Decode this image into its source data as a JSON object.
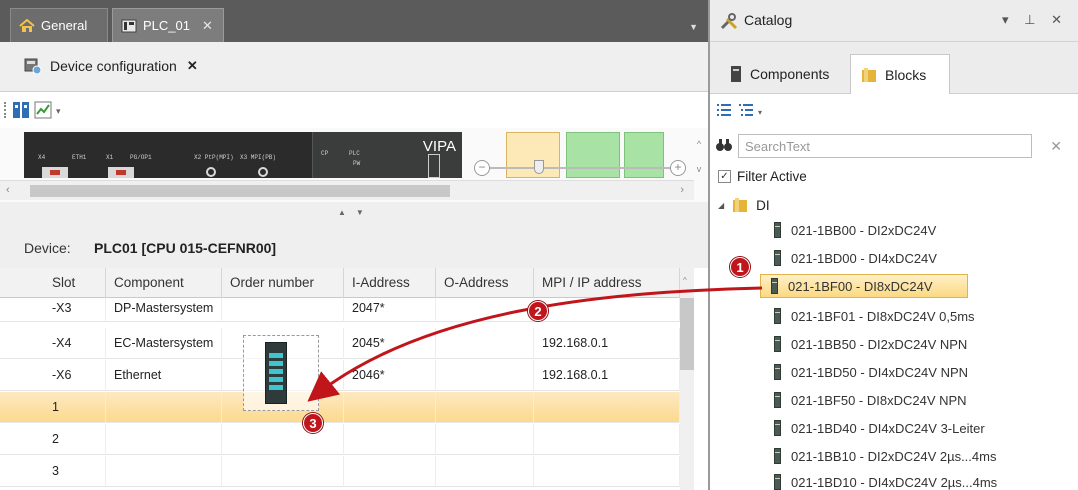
{
  "doc_tabs": [
    {
      "label": "General"
    },
    {
      "label": "PLC_01"
    }
  ],
  "sub_tab": {
    "label": "Device configuration"
  },
  "rack": {
    "labels": [
      "X4",
      "ETH1",
      "X1",
      "PG/OP1",
      "X2 PtP(MPI)",
      "X3 MPI(PB)",
      "CP",
      "PLC",
      "PW"
    ],
    "brand": "VIPA"
  },
  "device": {
    "label": "Device:",
    "name": "PLC01 [CPU 015-CEFNR00]"
  },
  "grid": {
    "columns": [
      "Slot",
      "Component",
      "Order number",
      "I-Address",
      "O-Address",
      "MPI / IP address"
    ],
    "rows": [
      {
        "slot": "-X3",
        "component": "DP-Mastersystem",
        "order": "",
        "iaddr": "2047*",
        "oaddr": "",
        "ip": ""
      },
      {
        "slot": "-X4",
        "component": "EC-Mastersystem",
        "order": "",
        "iaddr": "2045*",
        "oaddr": "",
        "ip": "192.168.0.1"
      },
      {
        "slot": "-X6",
        "component": "Ethernet",
        "order": "",
        "iaddr": "2046*",
        "oaddr": "",
        "ip": "192.168.0.1"
      },
      {
        "slot": "1",
        "component": "",
        "order": "",
        "iaddr": "",
        "oaddr": "",
        "ip": ""
      },
      {
        "slot": "2",
        "component": "",
        "order": "",
        "iaddr": "",
        "oaddr": "",
        "ip": ""
      },
      {
        "slot": "3",
        "component": "",
        "order": "",
        "iaddr": "",
        "oaddr": "",
        "ip": ""
      }
    ]
  },
  "catalog": {
    "title": "Catalog",
    "tabs": [
      {
        "label": "Components"
      },
      {
        "label": "Blocks"
      }
    ],
    "search": {
      "placeholder": "SearchText",
      "value": ""
    },
    "filter_label": "Filter Active",
    "folder": "DI",
    "items": [
      "021-1BB00 - DI2xDC24V",
      "021-1BD00 - DI4xDC24V",
      "021-1BF00 - DI8xDC24V",
      "021-1BF01 - DI8xDC24V 0,5ms",
      "021-1BB50 - DI2xDC24V NPN",
      "021-1BD50 - DI4xDC24V NPN",
      "021-1BF50 - DI8xDC24V NPN",
      "021-1BD40 - DI4xDC24V 3-Leiter",
      "021-1BB10 - DI2xDC24V 2µs...4ms",
      "021-1BD10 - DI4xDC24V 2µs...4ms"
    ]
  },
  "callouts": [
    "1",
    "2",
    "3"
  ],
  "colors": {
    "selection": "#fcd98d",
    "callout": "#c0151b",
    "arrow": "#c0151b"
  }
}
